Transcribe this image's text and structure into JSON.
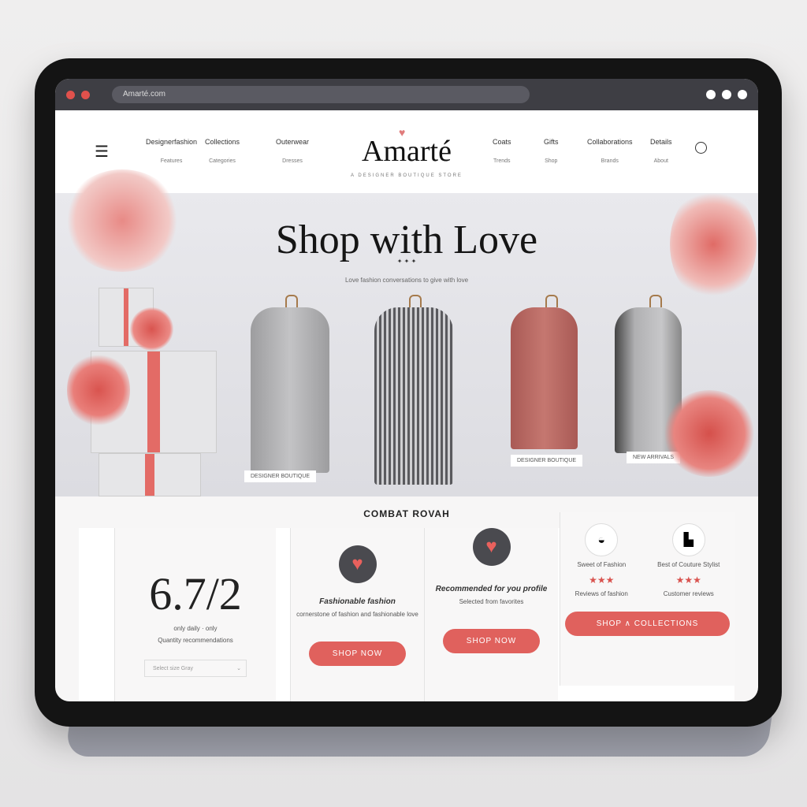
{
  "browser": {
    "url": "Amarté.com",
    "colors": {
      "close": "#e0514c",
      "min": "#e0514c"
    }
  },
  "nav": {
    "left": [
      {
        "label": "Designerfashion",
        "sub": "Features"
      },
      {
        "label": "Collections",
        "sub": "Categories"
      },
      {
        "label": "Outerwear",
        "sub": "Dresses"
      }
    ],
    "right": [
      {
        "label": "Coats",
        "sub": "Trends"
      },
      {
        "label": "Gifts",
        "sub": "Shop"
      },
      {
        "label": "Collaborations",
        "sub": "Brands"
      },
      {
        "label": "Details",
        "sub": "About"
      }
    ],
    "logo": "Amarté",
    "tagline": "A DESIGNER BOUTIQUE STORE"
  },
  "hero": {
    "title": "Shop with Love",
    "ornament": "✦ ✦ ✦",
    "subtitle": "Love fashion conversations to give with love",
    "labels": [
      "DESIGNER BOUTIQUE",
      "DESIGNER BOUTIQUE",
      "NEW ARRIVALS"
    ]
  },
  "section_title": "COMBAT ROVAH",
  "cards": [
    {
      "number": "6.7/2",
      "sub": "only daily · only",
      "desc": "Quantity recommendations",
      "select": "Select size  Gray"
    },
    {
      "title": "Fashionable fashion",
      "desc": "cornerstone of fashion and fashionable love",
      "button": "SHOP NOW"
    },
    {
      "title": "Recommended for you profile",
      "desc": "Selected from favorites",
      "button": "SHOP NOW"
    },
    {
      "reviews": [
        {
          "title": "Sweet of Fashion",
          "stars": 3,
          "note": "Reviews of fashion"
        },
        {
          "title": "Best of Couture Stylist",
          "stars": 3,
          "note": "Customer reviews"
        }
      ],
      "button": "SHOP  ∧  COLLECTIONS"
    }
  ],
  "accent": "#e0615d"
}
